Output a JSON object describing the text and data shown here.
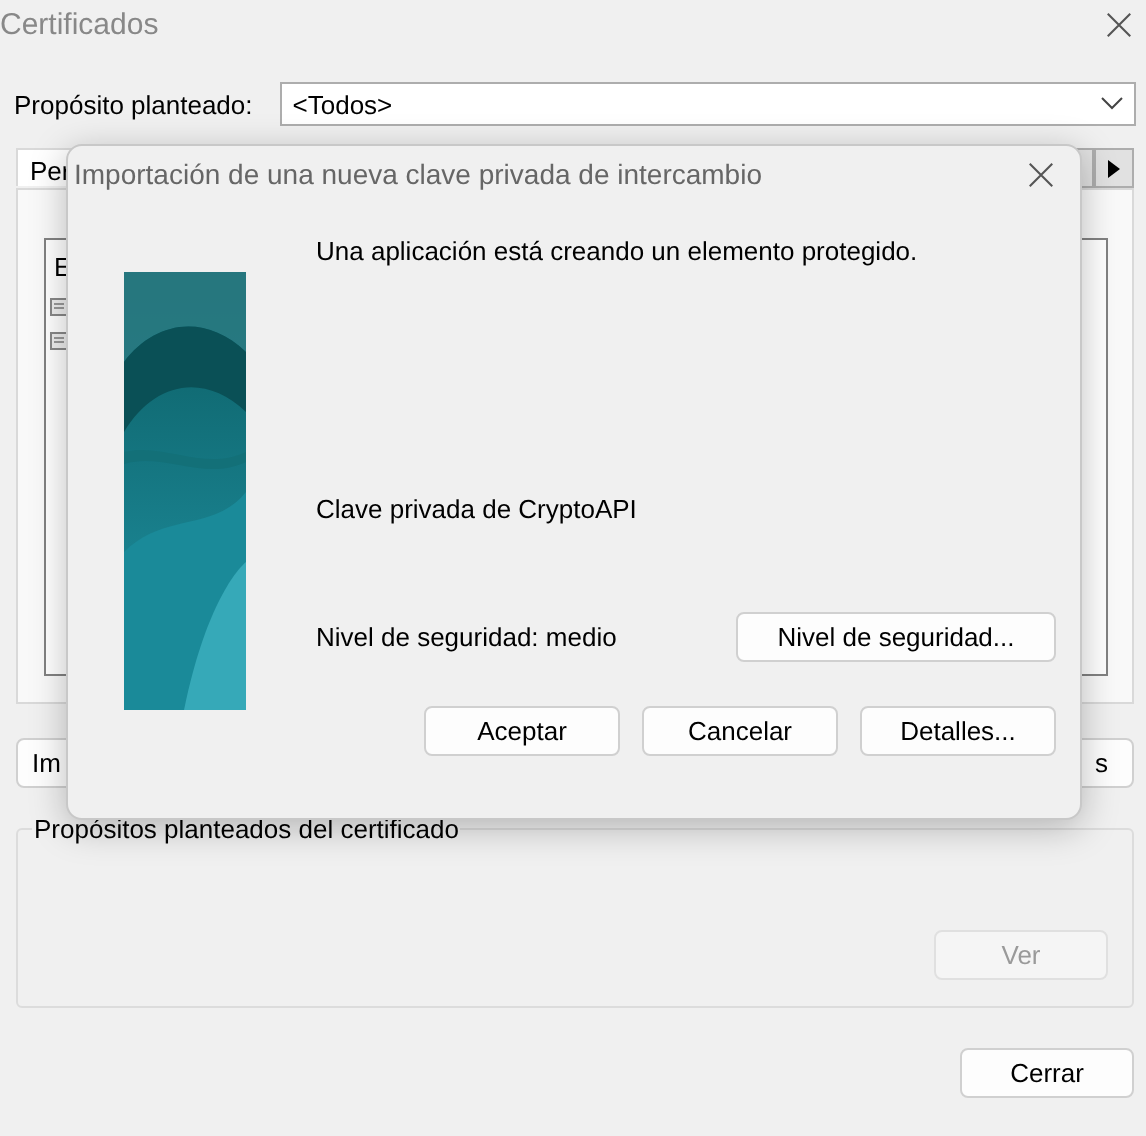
{
  "window": {
    "title": "Certificados"
  },
  "purpose": {
    "label": "Propósito planteado:",
    "value": "<Todos>"
  },
  "tabs": [
    {
      "label": "Per",
      "selected": true
    }
  ],
  "list": {
    "column_1": "E"
  },
  "buttons": [
    "Im",
    "s"
  ],
  "group": {
    "title": "Propósitos planteados del certificado",
    "button": {
      "label": "Ver",
      "disabled": true
    }
  },
  "close_button": "Cerrar",
  "dialog": {
    "title": "Importación de una nueva clave privada de intercambio",
    "message": "Una aplicación está creando un elemento protegido.",
    "key_name": "Clave privada de CryptoAPI",
    "security_level": "Nivel de seguridad: medio",
    "security_button": "Nivel de seguridad...",
    "buttons": [
      "Aceptar",
      "Cancelar",
      "Detalles..."
    ]
  }
}
